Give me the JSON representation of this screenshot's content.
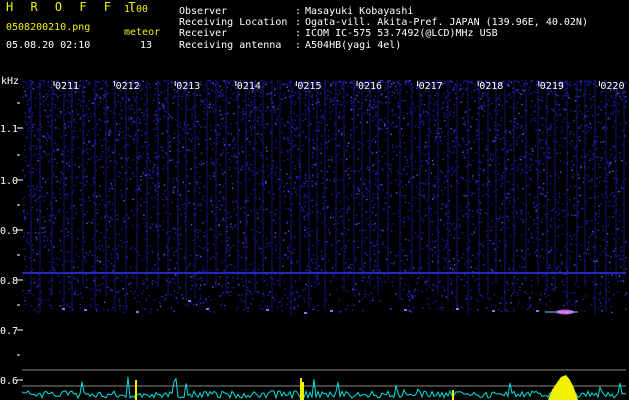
{
  "app": {
    "name": "H R O F F T",
    "version": "1.00"
  },
  "file": {
    "name": "0508200210.png",
    "datetime": "05.08.20 02:10"
  },
  "meteor": {
    "label": "meteor",
    "count": "13"
  },
  "info": [
    {
      "label": "Observer",
      "value": "Masayuki Kobayashi"
    },
    {
      "label": "Receiving Location",
      "value": "Ogata-vill. Akita-Pref. JAPAN (139.96E, 40.02N)"
    },
    {
      "label": "Receiver",
      "value": "ICOM IC-575 53.7492(@LCD)MHz USB"
    },
    {
      "label": "Receiving antenna",
      "value": "A504HB(yagi 4el)"
    }
  ],
  "separator": ":",
  "y_axis": {
    "unit": "kHz",
    "ticks": [
      "1.1",
      "1.0",
      "0.9",
      "0.8",
      "0.7",
      "0.6"
    ]
  },
  "time_ticks": [
    "0211",
    "0212",
    "0213",
    "0214",
    "0215",
    "0216",
    "0217",
    "0218",
    "0219",
    "0220"
  ],
  "colors": {
    "background": "#000000",
    "noise": "#2020c8",
    "label": "#f2f200",
    "trace": "#00e0e0",
    "event": "#f2f200"
  }
}
